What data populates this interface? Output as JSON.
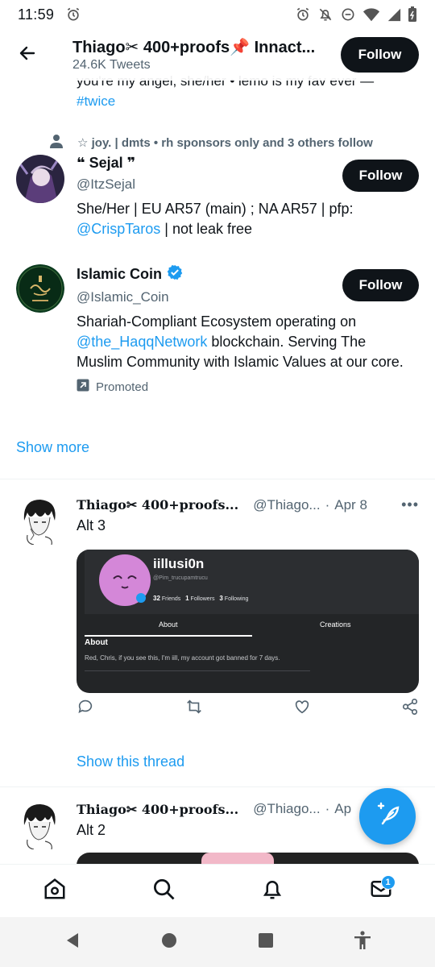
{
  "status_bar": {
    "time": "11:59"
  },
  "header": {
    "title": "Thiago✂ 400+proofs📌 Innact...",
    "subtitle": "24.6K Tweets",
    "follow_label": "Follow"
  },
  "peek": {
    "text": "you're my angel, she/her • lemo is my fav ever —",
    "tag": "#twice"
  },
  "social_context": "☆ joy. | dmts • rh sponsors only and 3 others follow",
  "users": [
    {
      "name": "❝ Sejal ❞",
      "handle": "@ItzSejal",
      "bio_pre": "She/Her | EU AR57 (main) ; NA AR57 | pfp: ",
      "bio_link": "@CrispTaros",
      "bio_post": " | not leak free",
      "follow_label": "Follow"
    },
    {
      "name": "Islamic Coin",
      "verified": true,
      "handle": "@Islamic_Coin",
      "bio_pre": "Shariah-Compliant Ecosystem operating on ",
      "bio_link": "@the_HaqqNetwork",
      "bio_post": " blockchain. Serving The Muslim Community with Islamic Values at our core.",
      "promoted": "Promoted",
      "follow_label": "Follow"
    }
  ],
  "show_more": "Show more",
  "tweets": [
    {
      "name": "Thiago✂ 400+proofs...",
      "handle": "@Thiago...",
      "date": "Apr 8",
      "text": "Alt 3",
      "card": {
        "profile_name": "iillusi0n",
        "profile_sub": "@Pim_trucupamtrucu",
        "friends": "32",
        "friends_label": "Friends",
        "followers": "1",
        "followers_label": "Followers",
        "following": "3",
        "following_label": "Following",
        "tab_about": "About",
        "tab_creations": "Creations",
        "about_title": "About",
        "about_text": "Red, Chris, if you see this, I'm iill, my account got banned for 7 days."
      },
      "show_thread": "Show this thread"
    },
    {
      "name": "Thiago✂ 400+proofs...",
      "handle": "@Thiago...",
      "date": "Ap",
      "text": "Alt 2"
    }
  ],
  "bottom_nav": {
    "messages_badge": "1"
  },
  "colors": {
    "accent": "#1d9bf0",
    "text": "#0f1419",
    "muted": "#536471"
  }
}
